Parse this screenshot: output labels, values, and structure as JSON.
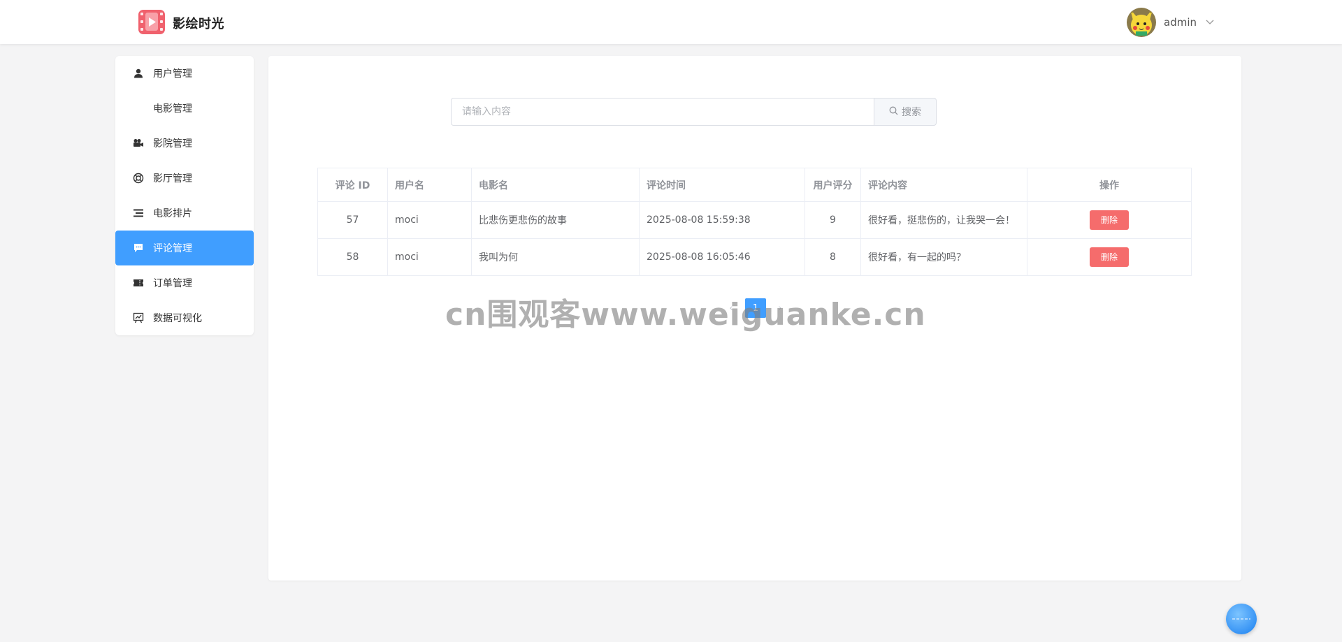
{
  "header": {
    "brand": "影绘时光",
    "username": "admin"
  },
  "sidebar": {
    "items": [
      {
        "label": "用户管理",
        "icon": "user-icon"
      },
      {
        "label": "电影管理",
        "icon": ""
      },
      {
        "label": "影院管理",
        "icon": "camera-icon"
      },
      {
        "label": "影厅管理",
        "icon": "hall-icon"
      },
      {
        "label": "电影排片",
        "icon": "list-icon"
      },
      {
        "label": "评论管理",
        "icon": "comment-icon",
        "active": true
      },
      {
        "label": "订单管理",
        "icon": "ticket-icon"
      },
      {
        "label": "数据可视化",
        "icon": "chart-icon"
      }
    ]
  },
  "search": {
    "placeholder": "请输入内容",
    "button_label": "搜索"
  },
  "table": {
    "columns": [
      "评论 ID",
      "用户名",
      "电影名",
      "评论时间",
      "用户评分",
      "评论内容",
      "操作"
    ],
    "rows": [
      {
        "id": "57",
        "user": "moci",
        "movie": "比悲伤更悲伤的故事",
        "time": "2025-08-08 15:59:38",
        "score": "9",
        "content": "很好看，挺悲伤的，让我哭一会！",
        "action": "删除"
      },
      {
        "id": "58",
        "user": "moci",
        "movie": "我叫为何",
        "time": "2025-08-08 16:05:46",
        "score": "8",
        "content": "很好看，有一起的吗？",
        "action": "删除"
      }
    ]
  },
  "pagination": {
    "current": "1"
  },
  "watermark": "cn围观客www.weiguanke.cn",
  "colors": {
    "primary": "#409eff",
    "danger": "#f56c6c",
    "background": "#f4f4f5"
  }
}
